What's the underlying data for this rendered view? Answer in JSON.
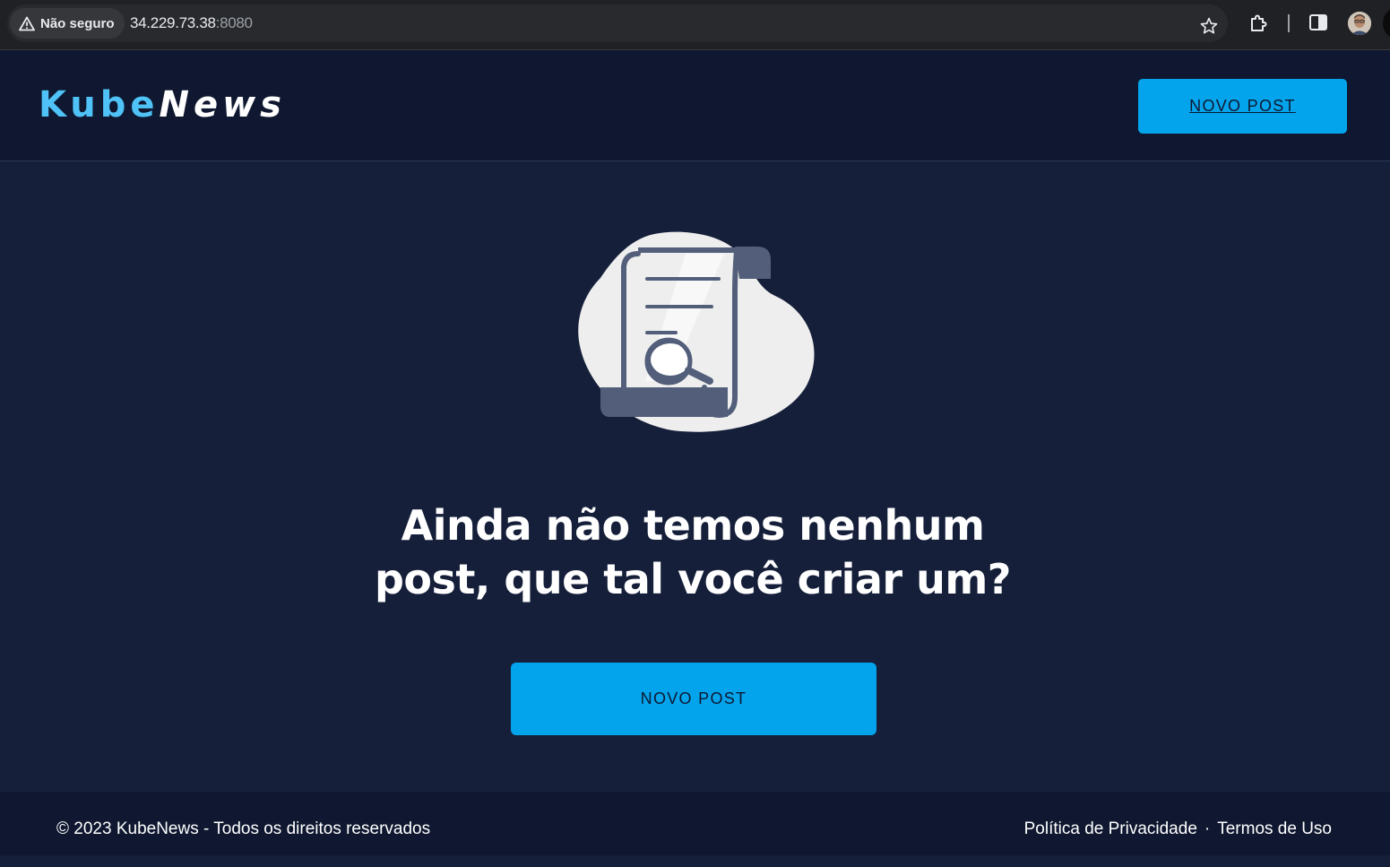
{
  "browser": {
    "security_label": "Não seguro",
    "url_host": "34.229.73.38",
    "url_port": ":8080"
  },
  "header": {
    "logo_part1": "Kube",
    "logo_part2": "News",
    "new_post_label": "NOVO POST"
  },
  "main": {
    "headline_line1": "Ainda não temos nenhum",
    "headline_line2": "post, que tal você criar um?",
    "new_post_label": "NOVO POST"
  },
  "footer": {
    "copyright": "© 2023 KubeNews - Todos os direitos reservados",
    "privacy_link": "Política de Privacidade",
    "separator": "·",
    "terms_link": "Termos de Uso"
  },
  "colors": {
    "page_bg": "#151f3a",
    "header_bg": "#0f1830",
    "accent": "#03a4ec",
    "logo_accent": "#4fc3f7"
  },
  "icons": {
    "warning": "warning-triangle-icon",
    "bookmark": "star-icon",
    "extensions": "puzzle-icon",
    "side_panel": "side-panel-icon",
    "profile": "avatar",
    "empty_state": "document-search-illustration"
  }
}
